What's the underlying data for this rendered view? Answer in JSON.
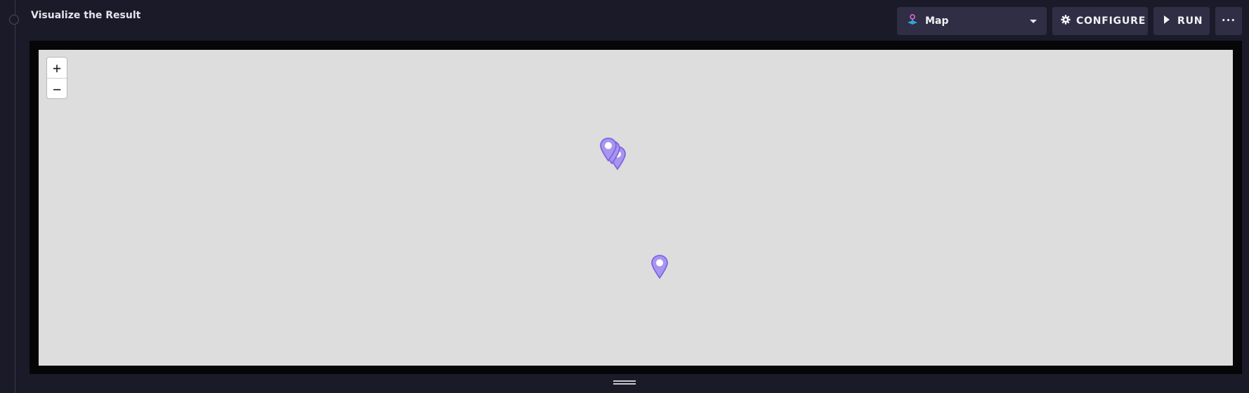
{
  "panel": {
    "title": "Visualize the Result"
  },
  "toolbar": {
    "visualization_type": "Map",
    "configure_label": "CONFIGURE",
    "run_label": "RUN",
    "more_label": "•••"
  },
  "map": {
    "zoom_in_label": "+",
    "zoom_out_label": "−",
    "background_color": "#dddddd",
    "marker_color": "#9b87ee",
    "marker_count": 4
  },
  "colors": {
    "panel_background": "#1b1a29",
    "button_background": "#2f2e44",
    "frame_background": "#060608"
  }
}
